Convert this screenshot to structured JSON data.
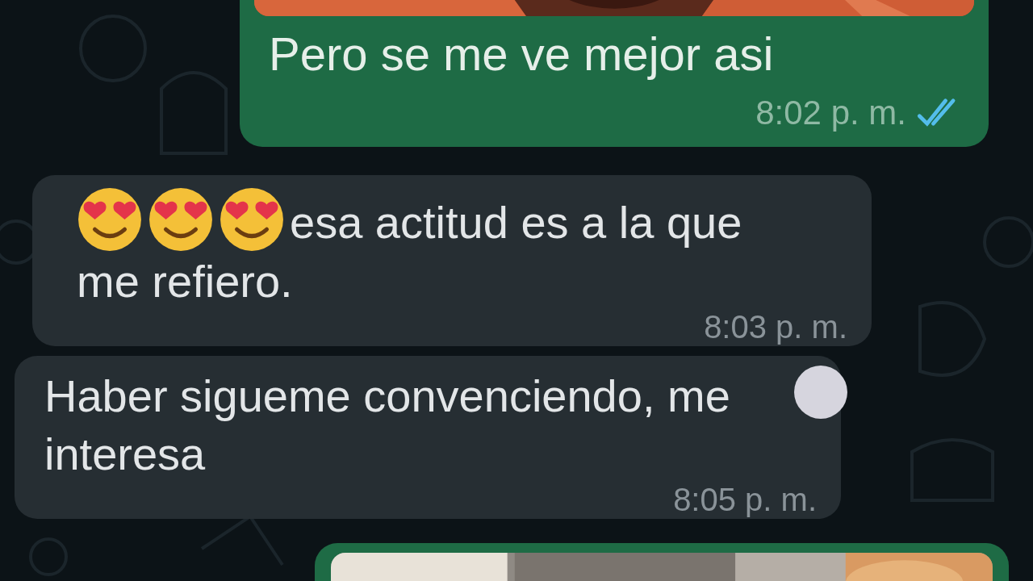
{
  "messages": [
    {
      "kind": "outgoing",
      "picture": true,
      "text": "Pero se me ve mejor asi",
      "time": "8:02 p. m.",
      "read": true
    },
    {
      "kind": "incoming",
      "emojis": [
        {
          "kind": "heart-eyes"
        },
        {
          "kind": "heart-eyes"
        },
        {
          "kind": "heart-eyes"
        }
      ],
      "text": "esa actitud es a la que me refiero.",
      "time": "8:03 p. m."
    },
    {
      "kind": "incoming",
      "text": "Haber sigueme convenciendo, me interesa",
      "time": "8:05 p. m.",
      "overlay_dot": true
    },
    {
      "kind": "outgoing",
      "picture": true
    }
  ]
}
